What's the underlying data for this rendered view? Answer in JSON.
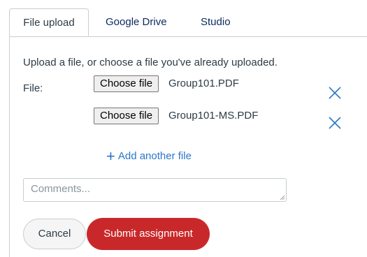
{
  "tabs": [
    {
      "label": "File upload",
      "active": true
    },
    {
      "label": "Google Drive",
      "active": false
    },
    {
      "label": "Studio",
      "active": false
    }
  ],
  "upload": {
    "instructions": "Upload a file, or choose a file you've already uploaded.",
    "file_label": "File:",
    "files": [
      {
        "button_label": "Choose file",
        "file_name": "Group101.PDF",
        "remove_icon": "close-x-icon"
      },
      {
        "button_label": "Choose file",
        "file_name": "Group101-MS.PDF",
        "remove_icon": "close-x-icon"
      }
    ],
    "add_another_label": "Add another file",
    "add_icon": "plus-icon"
  },
  "comments": {
    "placeholder": "Comments...",
    "value": ""
  },
  "actions": {
    "cancel_label": "Cancel",
    "submit_label": "Submit assignment"
  },
  "colors": {
    "accent_blue": "#2a77c9",
    "tab_link": "#0e2a61",
    "submit_red": "#c9282a",
    "border": "#c7cdd1",
    "text": "#2d3b45"
  }
}
